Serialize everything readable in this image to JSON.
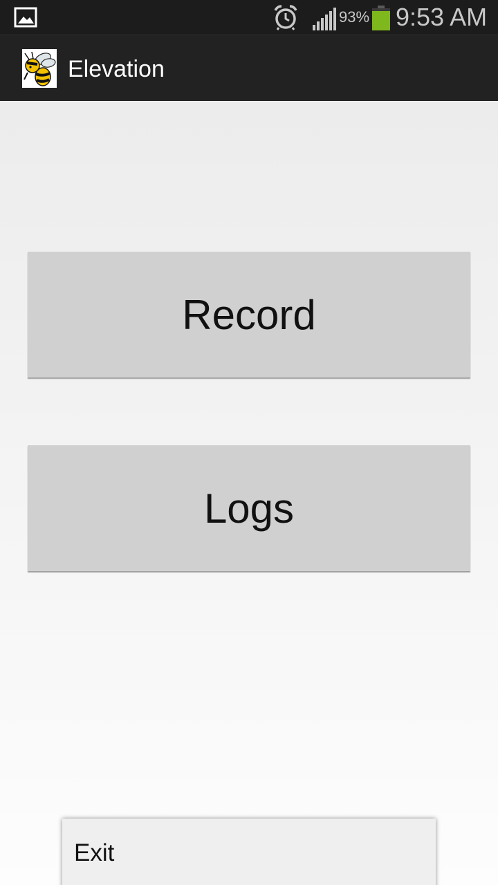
{
  "status_bar": {
    "battery_percent": "93%",
    "time": "9:53 AM",
    "notification_icon": "gallery-icon",
    "alarm_icon": "alarm-clock-icon",
    "signal_icon": "cell-signal-icon",
    "battery_icon": "battery-icon",
    "battery_level": 0.93,
    "battery_color": "#7fb81c"
  },
  "action_bar": {
    "title": "Elevation",
    "logo_icon": "yellow-jacket-logo"
  },
  "main": {
    "record_label": "Record",
    "logs_label": "Logs"
  },
  "options_menu": {
    "items": [
      {
        "label": "Exit"
      }
    ]
  },
  "colors": {
    "status_bar_bg": "#1c1c1c",
    "action_bar_bg": "#222222",
    "button_bg": "#d0d0d0"
  }
}
